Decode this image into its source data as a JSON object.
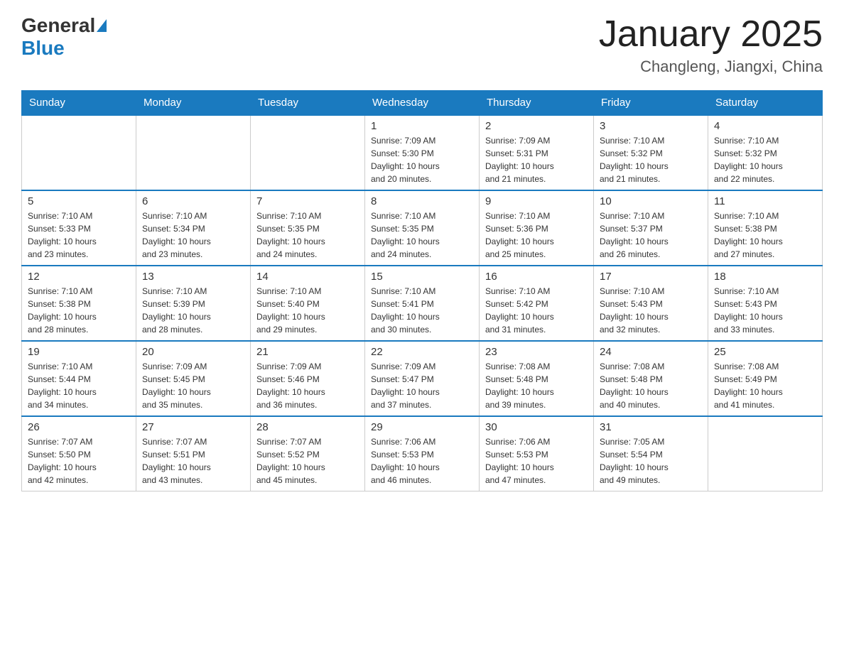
{
  "header": {
    "logo_general": "General",
    "logo_blue": "Blue",
    "month_title": "January 2025",
    "location": "Changleng, Jiangxi, China"
  },
  "days_of_week": [
    "Sunday",
    "Monday",
    "Tuesday",
    "Wednesday",
    "Thursday",
    "Friday",
    "Saturday"
  ],
  "weeks": [
    {
      "days": [
        {
          "number": "",
          "info": ""
        },
        {
          "number": "",
          "info": ""
        },
        {
          "number": "",
          "info": ""
        },
        {
          "number": "1",
          "info": "Sunrise: 7:09 AM\nSunset: 5:30 PM\nDaylight: 10 hours\nand 20 minutes."
        },
        {
          "number": "2",
          "info": "Sunrise: 7:09 AM\nSunset: 5:31 PM\nDaylight: 10 hours\nand 21 minutes."
        },
        {
          "number": "3",
          "info": "Sunrise: 7:10 AM\nSunset: 5:32 PM\nDaylight: 10 hours\nand 21 minutes."
        },
        {
          "number": "4",
          "info": "Sunrise: 7:10 AM\nSunset: 5:32 PM\nDaylight: 10 hours\nand 22 minutes."
        }
      ]
    },
    {
      "days": [
        {
          "number": "5",
          "info": "Sunrise: 7:10 AM\nSunset: 5:33 PM\nDaylight: 10 hours\nand 23 minutes."
        },
        {
          "number": "6",
          "info": "Sunrise: 7:10 AM\nSunset: 5:34 PM\nDaylight: 10 hours\nand 23 minutes."
        },
        {
          "number": "7",
          "info": "Sunrise: 7:10 AM\nSunset: 5:35 PM\nDaylight: 10 hours\nand 24 minutes."
        },
        {
          "number": "8",
          "info": "Sunrise: 7:10 AM\nSunset: 5:35 PM\nDaylight: 10 hours\nand 24 minutes."
        },
        {
          "number": "9",
          "info": "Sunrise: 7:10 AM\nSunset: 5:36 PM\nDaylight: 10 hours\nand 25 minutes."
        },
        {
          "number": "10",
          "info": "Sunrise: 7:10 AM\nSunset: 5:37 PM\nDaylight: 10 hours\nand 26 minutes."
        },
        {
          "number": "11",
          "info": "Sunrise: 7:10 AM\nSunset: 5:38 PM\nDaylight: 10 hours\nand 27 minutes."
        }
      ]
    },
    {
      "days": [
        {
          "number": "12",
          "info": "Sunrise: 7:10 AM\nSunset: 5:38 PM\nDaylight: 10 hours\nand 28 minutes."
        },
        {
          "number": "13",
          "info": "Sunrise: 7:10 AM\nSunset: 5:39 PM\nDaylight: 10 hours\nand 28 minutes."
        },
        {
          "number": "14",
          "info": "Sunrise: 7:10 AM\nSunset: 5:40 PM\nDaylight: 10 hours\nand 29 minutes."
        },
        {
          "number": "15",
          "info": "Sunrise: 7:10 AM\nSunset: 5:41 PM\nDaylight: 10 hours\nand 30 minutes."
        },
        {
          "number": "16",
          "info": "Sunrise: 7:10 AM\nSunset: 5:42 PM\nDaylight: 10 hours\nand 31 minutes."
        },
        {
          "number": "17",
          "info": "Sunrise: 7:10 AM\nSunset: 5:43 PM\nDaylight: 10 hours\nand 32 minutes."
        },
        {
          "number": "18",
          "info": "Sunrise: 7:10 AM\nSunset: 5:43 PM\nDaylight: 10 hours\nand 33 minutes."
        }
      ]
    },
    {
      "days": [
        {
          "number": "19",
          "info": "Sunrise: 7:10 AM\nSunset: 5:44 PM\nDaylight: 10 hours\nand 34 minutes."
        },
        {
          "number": "20",
          "info": "Sunrise: 7:09 AM\nSunset: 5:45 PM\nDaylight: 10 hours\nand 35 minutes."
        },
        {
          "number": "21",
          "info": "Sunrise: 7:09 AM\nSunset: 5:46 PM\nDaylight: 10 hours\nand 36 minutes."
        },
        {
          "number": "22",
          "info": "Sunrise: 7:09 AM\nSunset: 5:47 PM\nDaylight: 10 hours\nand 37 minutes."
        },
        {
          "number": "23",
          "info": "Sunrise: 7:08 AM\nSunset: 5:48 PM\nDaylight: 10 hours\nand 39 minutes."
        },
        {
          "number": "24",
          "info": "Sunrise: 7:08 AM\nSunset: 5:48 PM\nDaylight: 10 hours\nand 40 minutes."
        },
        {
          "number": "25",
          "info": "Sunrise: 7:08 AM\nSunset: 5:49 PM\nDaylight: 10 hours\nand 41 minutes."
        }
      ]
    },
    {
      "days": [
        {
          "number": "26",
          "info": "Sunrise: 7:07 AM\nSunset: 5:50 PM\nDaylight: 10 hours\nand 42 minutes."
        },
        {
          "number": "27",
          "info": "Sunrise: 7:07 AM\nSunset: 5:51 PM\nDaylight: 10 hours\nand 43 minutes."
        },
        {
          "number": "28",
          "info": "Sunrise: 7:07 AM\nSunset: 5:52 PM\nDaylight: 10 hours\nand 45 minutes."
        },
        {
          "number": "29",
          "info": "Sunrise: 7:06 AM\nSunset: 5:53 PM\nDaylight: 10 hours\nand 46 minutes."
        },
        {
          "number": "30",
          "info": "Sunrise: 7:06 AM\nSunset: 5:53 PM\nDaylight: 10 hours\nand 47 minutes."
        },
        {
          "number": "31",
          "info": "Sunrise: 7:05 AM\nSunset: 5:54 PM\nDaylight: 10 hours\nand 49 minutes."
        },
        {
          "number": "",
          "info": ""
        }
      ]
    }
  ]
}
